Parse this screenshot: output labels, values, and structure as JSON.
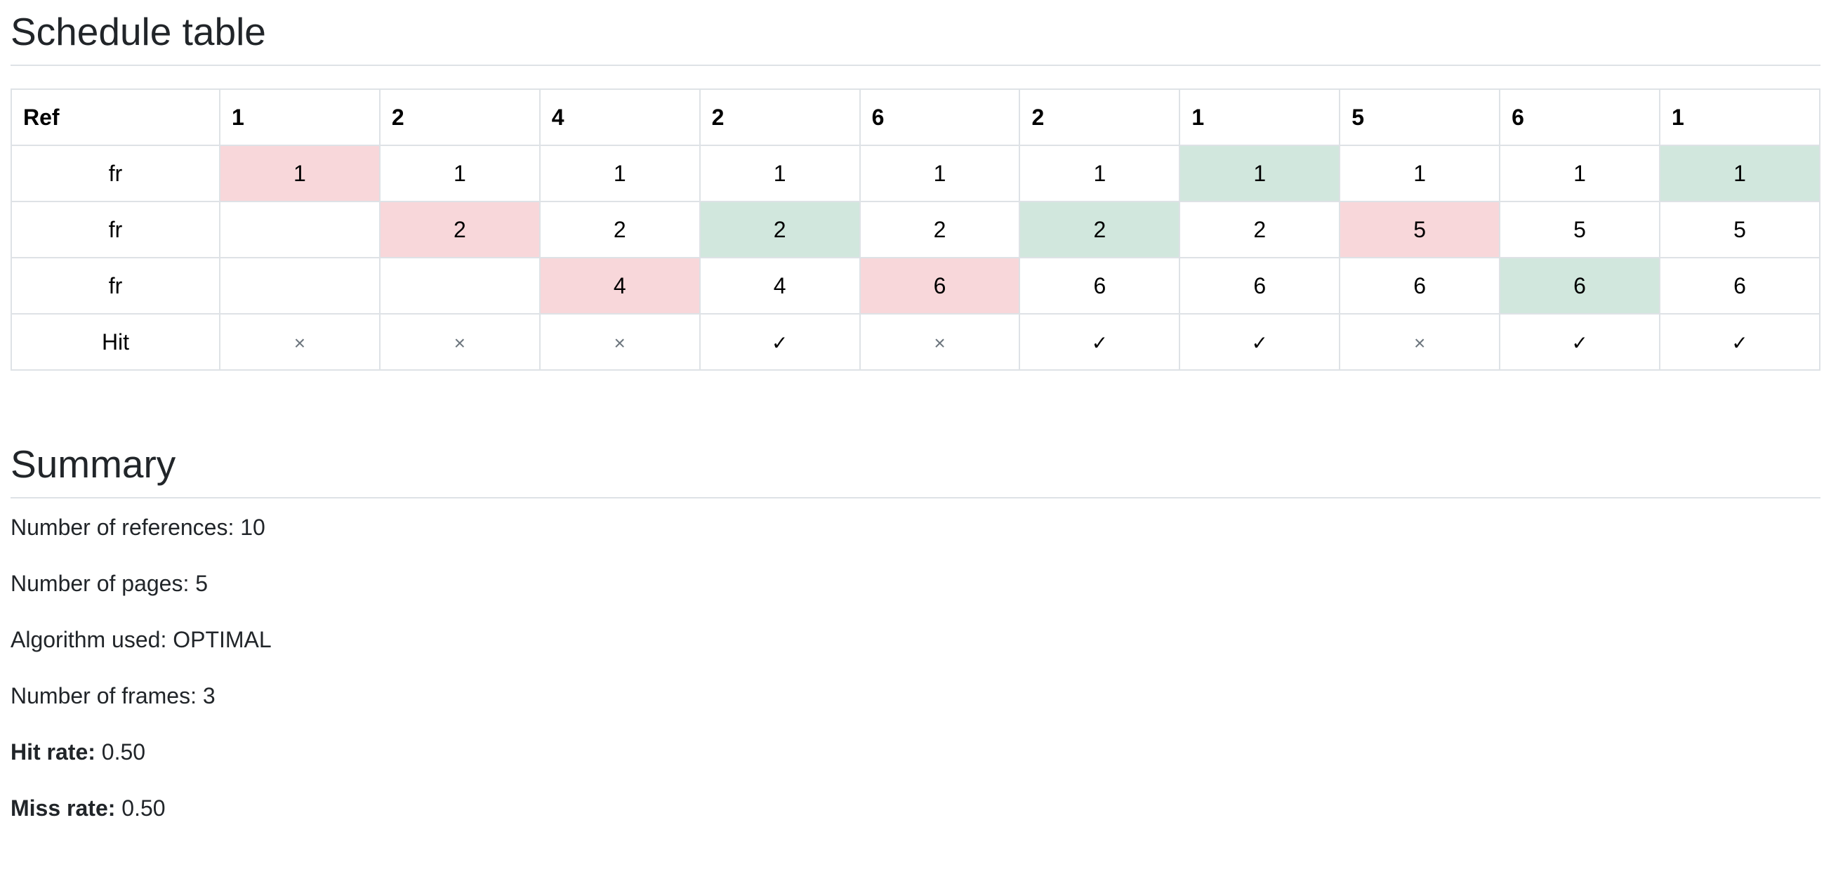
{
  "schedule": {
    "title": "Schedule table",
    "ref_label": "Ref",
    "refs": [
      "1",
      "2",
      "4",
      "2",
      "6",
      "2",
      "1",
      "5",
      "6",
      "1"
    ],
    "frame_label": "fr",
    "frames": [
      [
        "1",
        "1",
        "1",
        "1",
        "1",
        "1",
        "1",
        "1",
        "1",
        "1"
      ],
      [
        "",
        "2",
        "2",
        "2",
        "2",
        "2",
        "2",
        "5",
        "5",
        "5"
      ],
      [
        "",
        "",
        "4",
        "4",
        "6",
        "6",
        "6",
        "6",
        "6",
        "6"
      ]
    ],
    "frame_states": [
      [
        "miss",
        "",
        "",
        "",
        "",
        "",
        "hit",
        "",
        "",
        "hit"
      ],
      [
        "",
        "miss",
        "",
        "hit",
        "",
        "hit",
        "",
        "miss",
        "",
        ""
      ],
      [
        "",
        "",
        "miss",
        "",
        "miss",
        "",
        "",
        "",
        "hit",
        ""
      ]
    ],
    "hit_label": "Hit",
    "hits": [
      "×",
      "×",
      "×",
      "✓",
      "×",
      "✓",
      "✓",
      "×",
      "✓",
      "✓"
    ],
    "colors": {
      "miss": "#f8d7da",
      "hit": "#d1e7dd",
      "border": "#dee2e6"
    }
  },
  "summary": {
    "title": "Summary",
    "references": "Number of references: 10",
    "pages": "Number of pages: 5",
    "algorithm": "Algorithm used: OPTIMAL",
    "frames": "Number of frames: 3",
    "hit_rate_label": "Hit rate:",
    "hit_rate_value": " 0.50",
    "miss_rate_label": "Miss rate:",
    "miss_rate_value": " 0.50"
  }
}
